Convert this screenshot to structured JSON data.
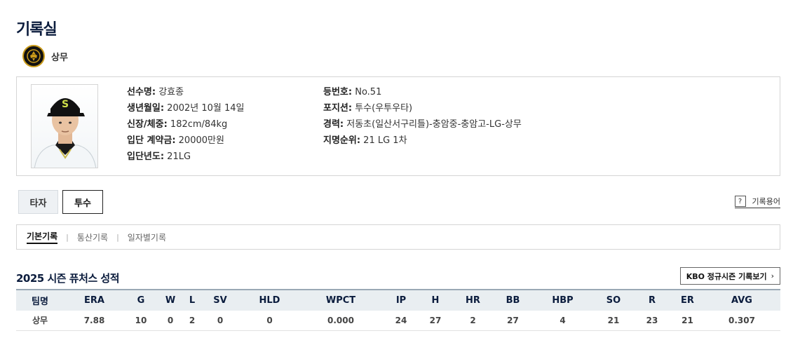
{
  "page_title": "기록실",
  "team": {
    "name": "상무",
    "emblem_icon": "sangmu-emblem-icon",
    "emblem_colors": [
      "#111111",
      "#c99a1a"
    ]
  },
  "player": {
    "photo_icon": "player-photo",
    "left": [
      {
        "label": "선수명:",
        "value": " 강효종"
      },
      {
        "label": "생년월일:",
        "value": " 2002년 10월 14일"
      },
      {
        "label": "신장/체중:",
        "value": " 182cm/84kg"
      },
      {
        "label": "입단 계약금:",
        "value": " 20000만원"
      },
      {
        "label": "입단년도:",
        "value": " 21LG"
      }
    ],
    "right": [
      {
        "label": "등번호:",
        "value": " No.51"
      },
      {
        "label": "포지션:",
        "value": " 투수(우투우타)"
      },
      {
        "label": "경력:",
        "value": " 저동초(일산서구리틀)-충암중-충암고-LG-상무"
      },
      {
        "label": "지명순위:",
        "value": " 21 LG 1차"
      }
    ]
  },
  "tabs": {
    "batter": "타자",
    "pitcher": "투수",
    "active": "pitcher"
  },
  "glossary": {
    "icon": "question-icon",
    "icon_glyph": "?",
    "label": "기록용어"
  },
  "subtabs": [
    "기본기록",
    "통산기록",
    "일자별기록"
  ],
  "season": {
    "title": "2025 시즌 퓨처스 성적",
    "kbo_link": "KBO 정규시즌 기록보기",
    "kbo_link_icon": "chevron-right-icon",
    "table": {
      "headers": [
        "팀명",
        "ERA",
        "G",
        "W",
        "L",
        "SV",
        "HLD",
        "WPCT",
        "IP",
        "H",
        "HR",
        "BB",
        "HBP",
        "SO",
        "R",
        "ER",
        "AVG"
      ],
      "rows": [
        [
          "상무",
          "7.88",
          "10",
          "0",
          "2",
          "0",
          "0",
          "0.000",
          "24",
          "27",
          "2",
          "27",
          "4",
          "21",
          "23",
          "21",
          "0.307"
        ]
      ]
    }
  },
  "colors": {
    "title_navy": "#0b1c3d",
    "header_bg": "#e9eef1",
    "border": "#d5d5d5"
  }
}
